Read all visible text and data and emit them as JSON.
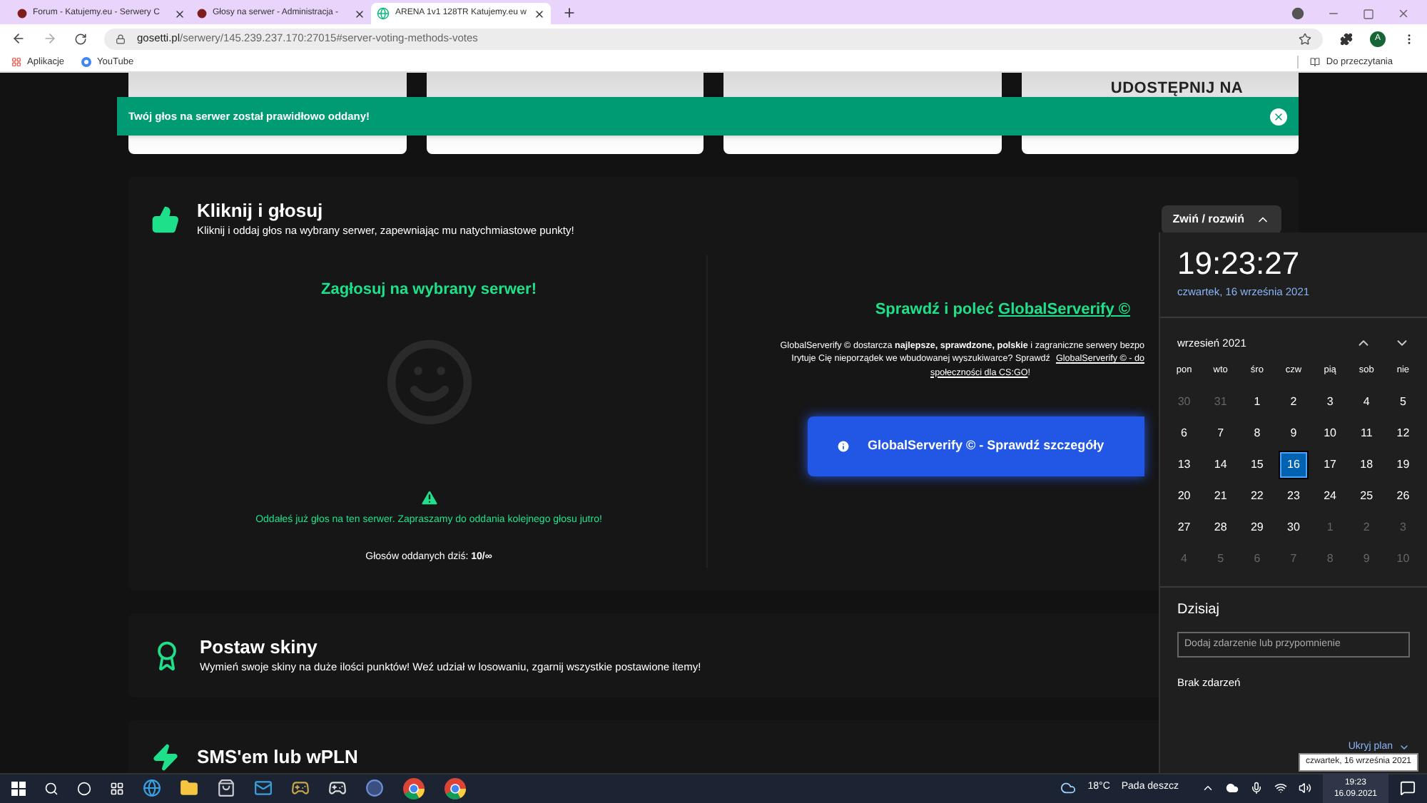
{
  "browser": {
    "tabs": [
      {
        "label": "Forum - Katujemy.eu - Serwery C",
        "selected": false
      },
      {
        "label": "Głosy na serwer - Administracja -",
        "selected": false
      },
      {
        "label": "ARENA 1v1 128TR Katujemy.eu w",
        "selected": true
      }
    ],
    "address": {
      "host": "gosetti.pl",
      "path": "/serwery/145.239.237.170:27015#server-voting-methods-votes"
    },
    "bookmarks": [
      "Aplikacje",
      "YouTube"
    ],
    "reading_list": "Do przeczytania",
    "profile": "A"
  },
  "top_cards": [
    {
      "kind": "plain"
    },
    {
      "kind": "plain"
    },
    {
      "kind": "plain"
    },
    {
      "kind": "titled",
      "title": "UDOSTĘPNIJ NA"
    }
  ],
  "toast": {
    "message": "Twój głos na serwer został prawidłowo oddany!"
  },
  "vote_section": {
    "title": "Kliknij i głosuj",
    "subtitle": "Kliknij i oddaj głos na wybrany serwer, zapewniając mu natychmiastowe punkty!",
    "toggle": "Zwiń / rozwiń",
    "expanded": true,
    "left": {
      "heading": "Zagłosuj na wybrany serwer!",
      "notice": "Oddałeś już głos na ten serwer. Zapraszamy do oddania kolejnego głosu jutro!",
      "count_label": "Głosów oddanych dziś:",
      "count_value": "10/∞"
    },
    "right": {
      "heading": "Sprawdź i poleć",
      "heading_link": "GlobalServerify ©",
      "line_1": "GlobalServerify © dostarcza **najlepsze, sprawdzone, polskie** i zagraniczne serwery bezpo",
      "line_2": "Irytuje Cię nieporządek we wbudowanej wyszukiwarce? Sprawdź",
      "link_1": "GlobalServerify © - do",
      "link_2": "społeczności dla CS:GO",
      "line_3_end": "!",
      "button": "GlobalServerify © - Sprawdź szczegóły"
    }
  },
  "sections": [
    {
      "kind": "skins",
      "title": "Postaw skiny",
      "subtitle": "Wymień swoje skiny na duże ilości punktów! Weź udział w losowaniu, zgarnij wszystkie postawione itemy!"
    },
    {
      "kind": "sms",
      "title": "SMS'em lub wPLN"
    }
  ],
  "calendar": {
    "time": "19:23:27",
    "date": "czwartek, 16 września 2021",
    "month": "wrzesień 2021",
    "weekdays": [
      "pon",
      "wto",
      "śro",
      "czw",
      "pią",
      "sob",
      "nie"
    ],
    "days": [
      {
        "label": "30",
        "muted": true,
        "selected": false
      },
      {
        "label": "31",
        "muted": true,
        "selected": false
      },
      {
        "label": "1",
        "muted": false,
        "selected": false
      },
      {
        "label": "2",
        "muted": false,
        "selected": false
      },
      {
        "label": "3",
        "muted": false,
        "selected": false
      },
      {
        "label": "4",
        "muted": false,
        "selected": false
      },
      {
        "label": "5",
        "muted": false,
        "selected": false
      },
      {
        "label": "6",
        "muted": false,
        "selected": false
      },
      {
        "label": "7",
        "muted": false,
        "selected": false
      },
      {
        "label": "8",
        "muted": false,
        "selected": false
      },
      {
        "label": "9",
        "muted": false,
        "selected": false
      },
      {
        "label": "10",
        "muted": false,
        "selected": false
      },
      {
        "label": "11",
        "muted": false,
        "selected": false
      },
      {
        "label": "12",
        "muted": false,
        "selected": false
      },
      {
        "label": "13",
        "muted": false,
        "selected": false
      },
      {
        "label": "14",
        "muted": false,
        "selected": false
      },
      {
        "label": "15",
        "muted": false,
        "selected": false
      },
      {
        "label": "16",
        "muted": false,
        "selected": true
      },
      {
        "label": "17",
        "muted": false,
        "selected": false
      },
      {
        "label": "18",
        "muted": false,
        "selected": false
      },
      {
        "label": "19",
        "muted": false,
        "selected": false
      },
      {
        "label": "20",
        "muted": false,
        "selected": false
      },
      {
        "label": "21",
        "muted": false,
        "selected": false
      },
      {
        "label": "22",
        "muted": false,
        "selected": false
      },
      {
        "label": "23",
        "muted": false,
        "selected": false
      },
      {
        "label": "24",
        "muted": false,
        "selected": false
      },
      {
        "label": "25",
        "muted": false,
        "selected": false
      },
      {
        "label": "26",
        "muted": false,
        "selected": false
      },
      {
        "label": "27",
        "muted": false,
        "selected": false
      },
      {
        "label": "28",
        "muted": false,
        "selected": false
      },
      {
        "label": "29",
        "muted": false,
        "selected": false
      },
      {
        "label": "30",
        "muted": false,
        "selected": false
      },
      {
        "label": "1",
        "muted": true,
        "selected": false
      },
      {
        "label": "2",
        "muted": true,
        "selected": false
      },
      {
        "label": "3",
        "muted": true,
        "selected": false
      },
      {
        "label": "4",
        "muted": true,
        "selected": false
      },
      {
        "label": "5",
        "muted": true,
        "selected": false
      },
      {
        "label": "6",
        "muted": true,
        "selected": false
      },
      {
        "label": "7",
        "muted": true,
        "selected": false
      },
      {
        "label": "8",
        "muted": true,
        "selected": false
      },
      {
        "label": "9",
        "muted": true,
        "selected": false
      },
      {
        "label": "10",
        "muted": true,
        "selected": false
      }
    ],
    "today_label": "Dzisiaj",
    "event_placeholder": "Dodaj zdarzenie lub przypomnienie",
    "no_events": "Brak zdarzeń",
    "hide_plan": "Ukryj plan"
  },
  "tooltip": "czwartek, 16 września 2021",
  "taskbar": {
    "weather": "18°C",
    "weather_text": "Pada deszcz",
    "time": "19:23",
    "date": "16.09.2021"
  }
}
